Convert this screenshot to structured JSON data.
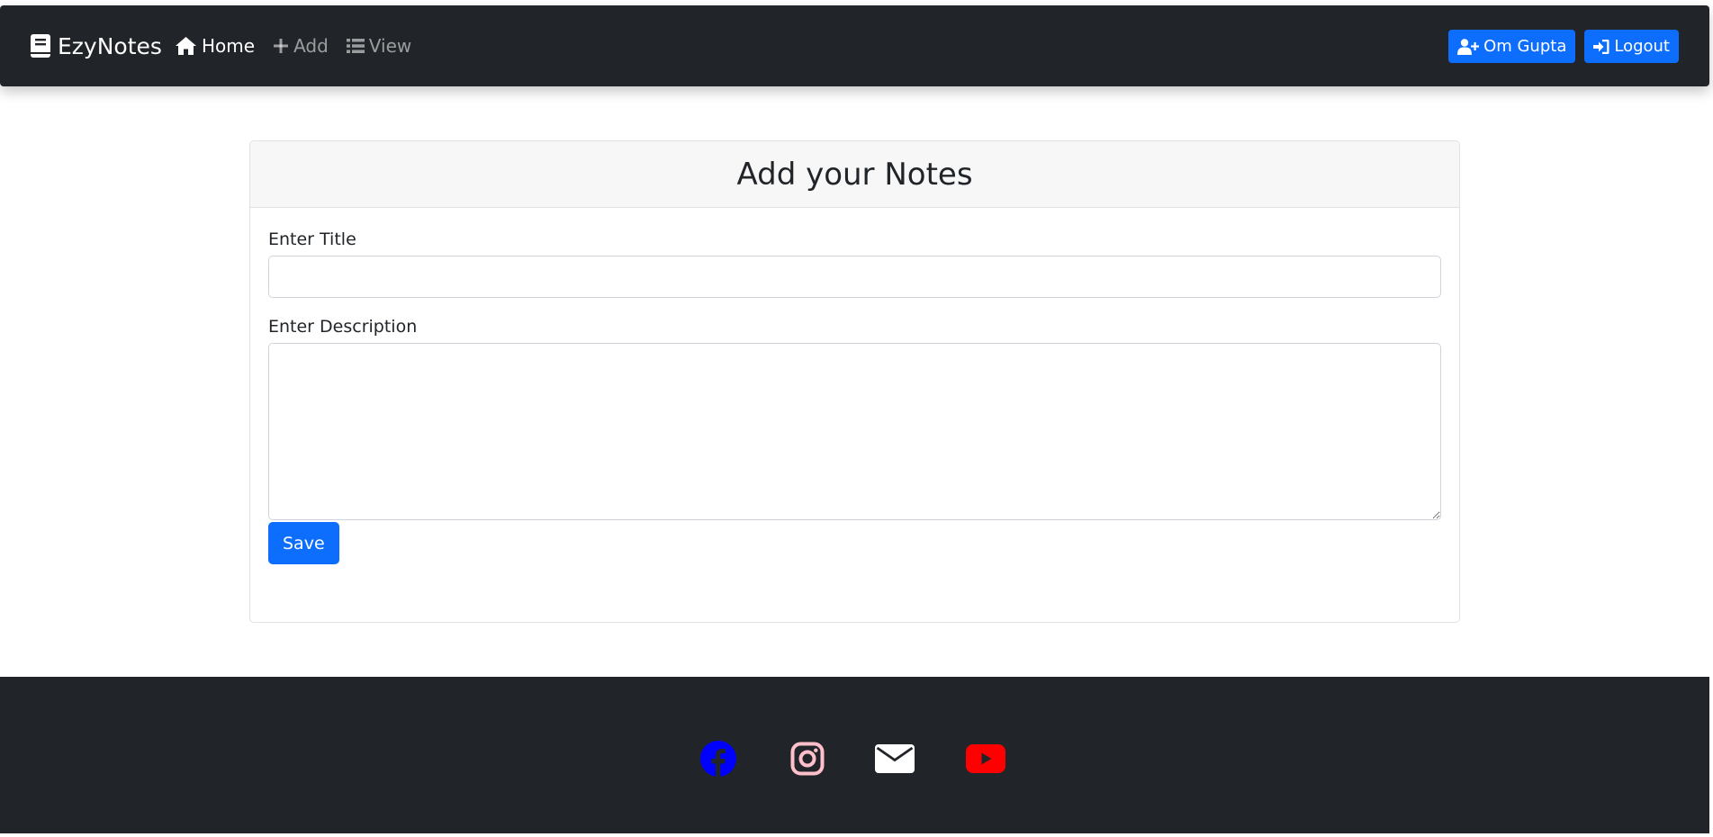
{
  "navbar": {
    "brand": "EzyNotes",
    "links": [
      {
        "label": "Home",
        "icon": "home-icon",
        "active": true
      },
      {
        "label": "Add",
        "icon": "plus-icon",
        "active": false
      },
      {
        "label": "View",
        "icon": "list-icon",
        "active": false
      }
    ],
    "user_button": "Om Gupta",
    "logout_button": "Logout"
  },
  "card": {
    "heading": "Add your Notes",
    "title_label": "Enter Title",
    "title_value": "",
    "description_label": "Enter Description",
    "description_value": "",
    "save_label": "Save"
  },
  "footer": {
    "icons": [
      "facebook-icon",
      "instagram-icon",
      "mail-icon",
      "youtube-icon"
    ]
  },
  "colors": {
    "navbar_bg": "#212529",
    "primary": "#0d6efd",
    "facebook": "#0000ff",
    "instagram": "#ffc0cb",
    "mail": "#ffffff",
    "youtube": "#ff0000"
  }
}
